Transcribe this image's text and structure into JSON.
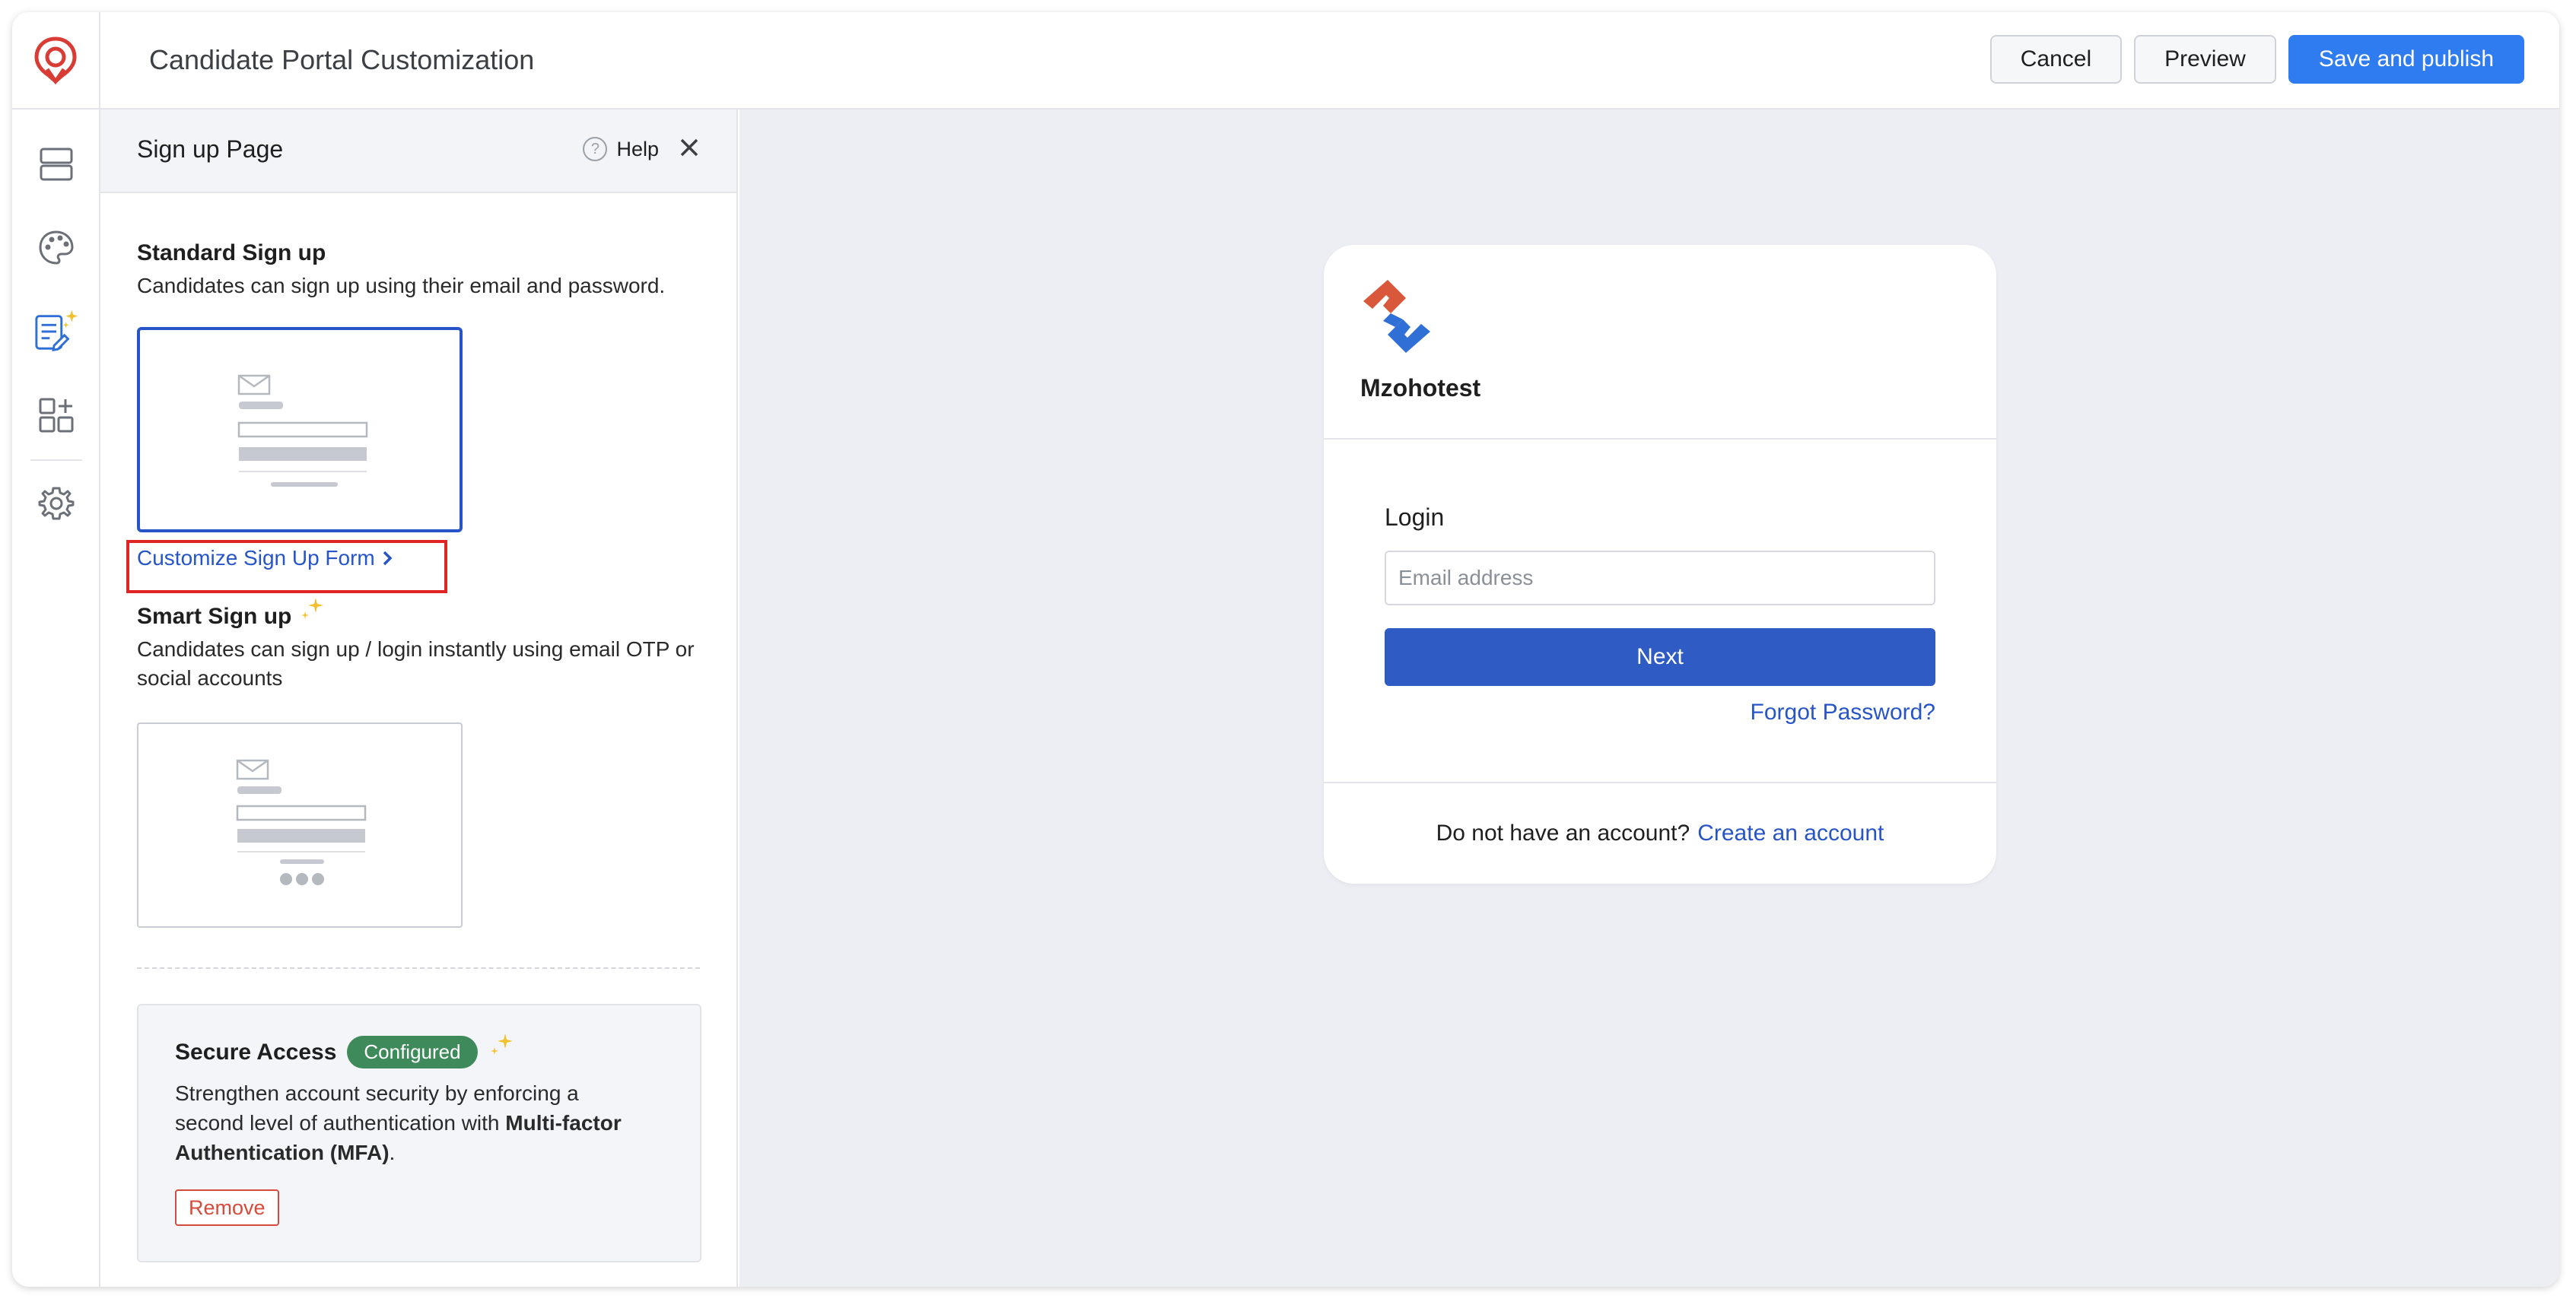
{
  "header": {
    "title": "Candidate Portal Customization",
    "cancel_label": "Cancel",
    "preview_label": "Preview",
    "publish_label": "Save and publish"
  },
  "rail": {
    "items": [
      "layout-icon",
      "palette-icon",
      "form-edit-icon",
      "add-widget-icon",
      "settings-icon"
    ]
  },
  "panel": {
    "title": "Sign up Page",
    "help_label": "Help",
    "standard": {
      "title": "Standard Sign up",
      "description": "Candidates can sign up using their email and password.",
      "link_label": "Customize Sign Up Form"
    },
    "smart": {
      "title": "Smart Sign up",
      "description_line1": "Candidates can sign up / login instantly using email OTP or",
      "description_line2": "social accounts"
    },
    "secure": {
      "title": "Secure Access",
      "badge": "Configured",
      "line1": "Strengthen account security by enforcing a",
      "line2": "second level of authentication with ",
      "line2_bold": "Multi-factor",
      "line3_bold": "Authentication (MFA)",
      "line3_end": ".",
      "remove_label": "Remove"
    }
  },
  "preview": {
    "brand_name": "Mzohotest",
    "login_label": "Login",
    "email_placeholder": "Email address",
    "next_label": "Next",
    "forgot_label": "Forgot Password?",
    "no_account_text": "Do not have an account?",
    "create_label": "Create an account"
  },
  "colors": {
    "accent": "#2755c8",
    "primary_button": "#2f7cf0",
    "badge": "#3f8a5a",
    "remove": "#d64b3b",
    "highlight": "#e02424"
  }
}
